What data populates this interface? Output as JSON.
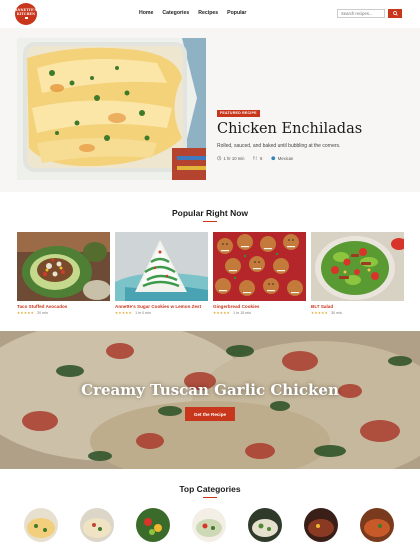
{
  "brand": {
    "logo_text": "ANNETTE'S KITCHEN",
    "accent": "#c8361c"
  },
  "nav": {
    "items": [
      "Home",
      "Categories",
      "Recipes",
      "Popular"
    ]
  },
  "search": {
    "placeholder": "Search recipes..."
  },
  "featured": {
    "label": "FEATURED RECIPE",
    "title": "Chicken Enchiladas",
    "description": "Rolled, sauced, and baked until bubbling at the corners.",
    "time": "1 hr 10 min",
    "servings": "6",
    "cuisine": "Mexican"
  },
  "popular": {
    "heading": "Popular Right Now",
    "cards": [
      {
        "title": "Taco Stuffed Avocados",
        "stars": "★★★★★",
        "time": "20 min"
      },
      {
        "title": "Annette's Sugar Cookies w Lemon Zest",
        "stars": "★★★★★",
        "time": "1 hr 0 min"
      },
      {
        "title": "Gingerbread Cookies",
        "stars": "★★★★★",
        "time": "1 hr 15 min"
      },
      {
        "title": "BLT Salad",
        "stars": "★★★★★",
        "time": "30 min"
      }
    ]
  },
  "hero": {
    "title": "Creamy Tuscan Garlic Chicken",
    "button": "Get the Recipe"
  },
  "categories": {
    "heading": "Top Categories"
  }
}
